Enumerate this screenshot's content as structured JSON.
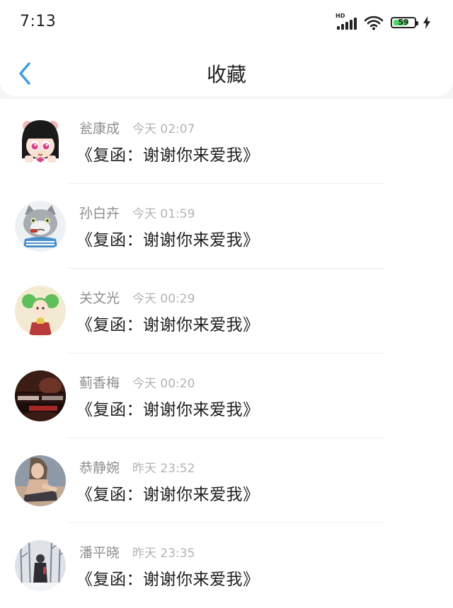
{
  "status_bar": {
    "time": "7:13",
    "network_label": "HD",
    "battery_level": "59",
    "icons": [
      "signal-icon",
      "wifi-icon",
      "battery-icon",
      "charging-icon"
    ]
  },
  "header": {
    "back_icon": "chevron-left-icon",
    "title": "收藏",
    "accent_color": "#3a9be8"
  },
  "favorites": [
    {
      "name": "瓮康成",
      "time": "今天 02:07",
      "message": "《复函：谢谢你来爱我》"
    },
    {
      "name": "孙白卉",
      "time": "今天 01:59",
      "message": "《复函：谢谢你来爱我》"
    },
    {
      "name": "关文光",
      "time": "今天 00:29",
      "message": "《复函：谢谢你来爱我》"
    },
    {
      "name": "蓟香梅",
      "time": "今天 00:20",
      "message": "《复函：谢谢你来爱我》"
    },
    {
      "name": "恭静婉",
      "time": "昨天 23:52",
      "message": "《复函：谢谢你来爱我》"
    },
    {
      "name": "潘平晓",
      "time": "昨天 23:35",
      "message": "《复函：谢谢你来爱我》"
    }
  ]
}
